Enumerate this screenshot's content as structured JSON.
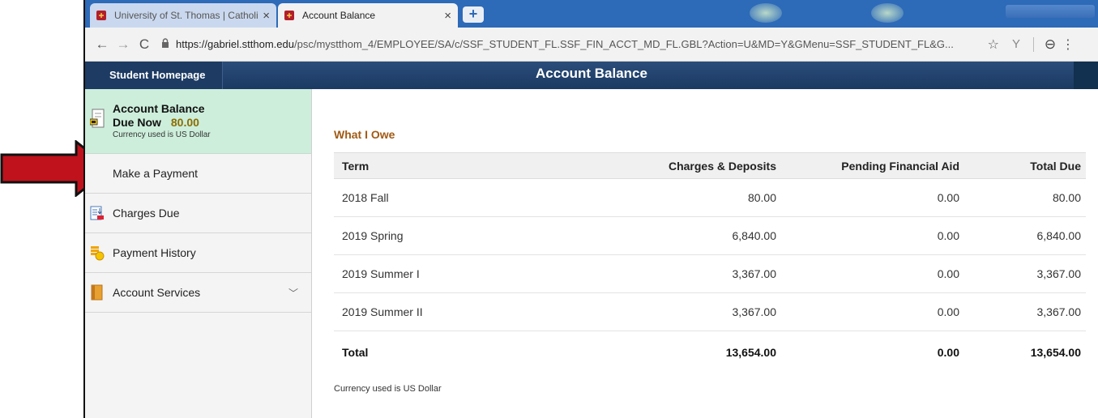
{
  "browser": {
    "tabs": [
      {
        "title": "University of St. Thomas | Catholi",
        "active": false
      },
      {
        "title": "Account Balance",
        "active": true
      }
    ],
    "tab_close": "×",
    "new_tab": "+",
    "url_host": "https://gabriel.stthom.edu",
    "url_path": "/psc/mystthom_4/EMPLOYEE/SA/c/SSF_STUDENT_FL.SSF_FIN_ACCT_MD_FL.GBL?Action=U&MD=Y&GMenu=SSF_STUDENT_FL&G...",
    "icons": {
      "back": "←",
      "forward": "→",
      "reload": "C",
      "lock": "🔒",
      "star": "☆",
      "ext": "Y",
      "account": "⊖",
      "menu": "⋮"
    }
  },
  "banner": {
    "home_button": "Student Homepage",
    "page_title": "Account Balance"
  },
  "sidebar": {
    "balance_card": {
      "title": "Account Balance",
      "due_label": "Due Now",
      "due_amount": "80.00",
      "currency_note": "Currency used is US Dollar"
    },
    "items": [
      {
        "label": "Make a Payment",
        "icon": null
      },
      {
        "label": "Charges Due",
        "icon": "charges-icon"
      },
      {
        "label": "Payment History",
        "icon": "payment-history-icon"
      },
      {
        "label": "Account Services",
        "icon": "account-services-icon",
        "chevron": "﹀"
      }
    ]
  },
  "main": {
    "section_title": "What I Owe",
    "table": {
      "headers": [
        "Term",
        "Charges & Deposits",
        "Pending Financial Aid",
        "Total Due"
      ],
      "rows": [
        [
          "2018 Fall",
          "80.00",
          "0.00",
          "80.00"
        ],
        [
          "2019 Spring",
          "6,840.00",
          "0.00",
          "6,840.00"
        ],
        [
          "2019 Summer I",
          "3,367.00",
          "0.00",
          "3,367.00"
        ],
        [
          "2019 Summer II",
          "3,367.00",
          "0.00",
          "3,367.00"
        ]
      ],
      "total": [
        "Total",
        "13,654.00",
        "0.00",
        "13,654.00"
      ]
    },
    "currency_note": "Currency used is US Dollar"
  },
  "colors": {
    "banner": "#1b3a63",
    "balance_card": "#cdeedb",
    "section_title": "#a05a14",
    "arrow": "#c0121c"
  }
}
